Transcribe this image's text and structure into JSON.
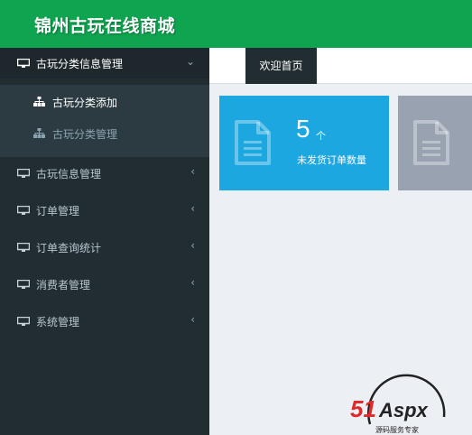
{
  "app": {
    "title": "锦州古玩在线商城"
  },
  "sidebar": {
    "groups": [
      {
        "label": "古玩分类信息管理",
        "arrow": "⌄",
        "expanded": true,
        "children": [
          {
            "label": "古玩分类添加"
          },
          {
            "label": "古玩分类管理"
          }
        ]
      },
      {
        "label": "古玩信息管理",
        "arrow": "‹"
      },
      {
        "label": "订单管理",
        "arrow": "‹"
      },
      {
        "label": "订单查询统计",
        "arrow": "‹"
      },
      {
        "label": "消费者管理",
        "arrow": "‹"
      },
      {
        "label": "系统管理",
        "arrow": "‹"
      }
    ]
  },
  "tabs": [
    {
      "label": "欢迎首页"
    }
  ],
  "cards": [
    {
      "count": "5",
      "unit": "个",
      "description": "未发货订单数量",
      "color": "#1ca7e0"
    },
    {
      "color": "#98a2b1"
    }
  ],
  "watermark": {
    "brand": "51Aspx",
    "tagline": "源码服务专家"
  },
  "colors": {
    "header": "#0fa550",
    "sidebar": "#222d32",
    "accent_red": "#e02a2a"
  }
}
